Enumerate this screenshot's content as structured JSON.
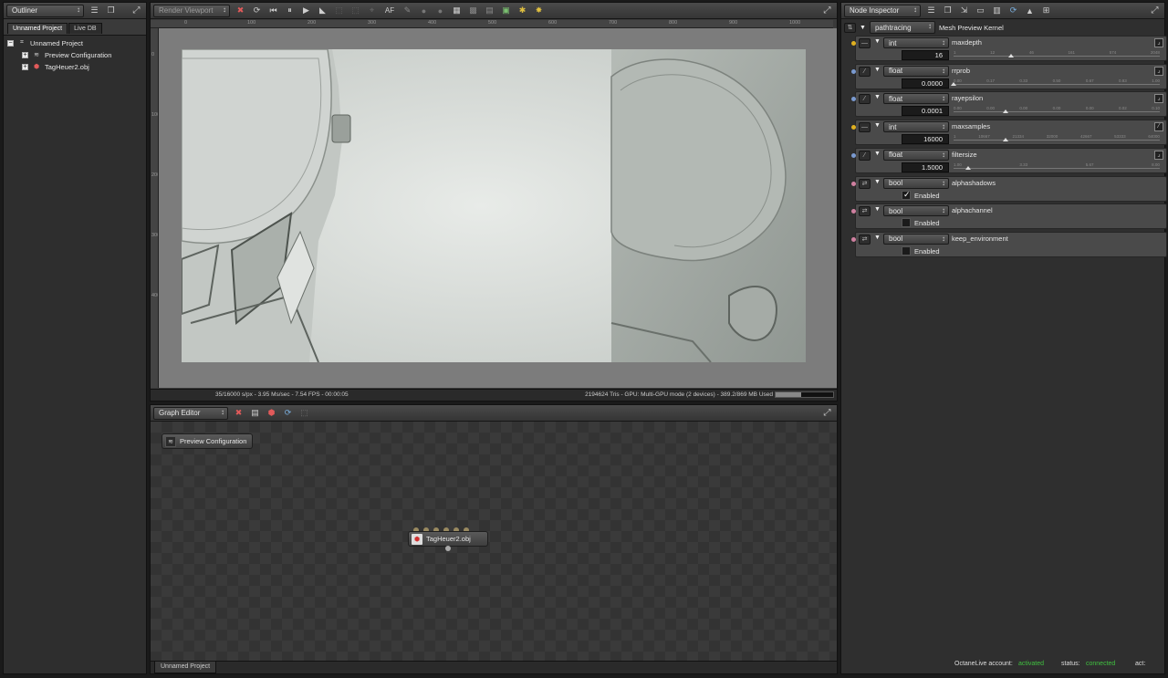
{
  "outliner": {
    "title": "Outliner",
    "tabs": [
      "Unnamed Project",
      "Live DB"
    ],
    "tree": {
      "root": "Unnamed Project",
      "children": [
        "Preview Configuration",
        "TagHeuer2.obj"
      ]
    }
  },
  "viewport": {
    "title": "Render Viewport",
    "toolbar_af": "AF",
    "ruler_top": [
      "0",
      "100",
      "200",
      "300",
      "400",
      "500",
      "600",
      "700",
      "800",
      "900",
      "1000"
    ],
    "ruler_left": [
      "0",
      "100",
      "200",
      "300",
      "400"
    ],
    "status_left": "35/16000 s/px - 3.95 Ms/sec - 7.54 FPS - 00:00:05",
    "status_right": "2194624 Tris - GPU: Multi-GPU mode (2 devices) - 389.2/869 MB Used",
    "memory_used_fraction": 0.448
  },
  "graph": {
    "title": "Graph Editor",
    "nodes": {
      "preview": "Preview Configuration",
      "obj": "TagHeuer2.obj"
    },
    "bottom_tab": "Unnamed Project"
  },
  "inspector": {
    "title": "Node Inspector",
    "kernel_type": "pathtracing",
    "kernel_label": "Mesh Preview Kernel",
    "params": [
      {
        "type": "int",
        "name": "maxdepth",
        "value": "16",
        "scale": [
          "1",
          "",
          "12",
          "",
          "46",
          "",
          "161",
          "",
          "574",
          "",
          "2048"
        ],
        "thumb": 0.28,
        "pin": "#e0b020"
      },
      {
        "type": "float",
        "name": "rrprob",
        "value": "0.0000",
        "scale": [
          "0.00",
          "",
          "0.17",
          "",
          "0.33",
          "",
          "0.50",
          "",
          "0.67",
          "",
          "0.83",
          "",
          "1.00"
        ],
        "thumb": 0.0,
        "pin": "#7a9ad0"
      },
      {
        "type": "float",
        "name": "rayepsilon",
        "value": "0.0001",
        "scale": [
          "0.00",
          "",
          "0.00",
          "",
          "0.00",
          "",
          "0.00",
          "",
          "0.00",
          "",
          "0.02",
          "",
          "0.10"
        ],
        "thumb": 0.25,
        "pin": "#7a9ad0"
      },
      {
        "type": "int",
        "name": "maxsamples",
        "value": "16000",
        "scale": [
          "1",
          "",
          "10667",
          "",
          "21334",
          "",
          "32000",
          "",
          "42667",
          "",
          "53333",
          "",
          "64000"
        ],
        "thumb": 0.25,
        "pin": "#e0b020"
      },
      {
        "type": "float",
        "name": "filtersize",
        "value": "1.5000",
        "scale": [
          "1.00",
          "",
          "",
          "3.33",
          "",
          "",
          "5.67",
          "",
          "",
          "8.00"
        ],
        "thumb": 0.07,
        "pin": "#7a9ad0"
      },
      {
        "type": "bool",
        "name": "alphashadows",
        "checked": true,
        "label": "Enabled",
        "pin": "#d080a0"
      },
      {
        "type": "bool",
        "name": "alphachannel",
        "checked": false,
        "label": "Enabled",
        "pin": "#d080a0"
      },
      {
        "type": "bool",
        "name": "keep_environment",
        "checked": false,
        "label": "Enabled",
        "pin": "#d080a0"
      }
    ]
  },
  "footer": {
    "account_label": "OctaneLive account:",
    "account_value": "activated",
    "status_label": "status:",
    "status_value": "connected",
    "act_label": "act:"
  },
  "colors": {
    "accent_green": "#40c040",
    "panel_bg": "#3a3a3a"
  }
}
